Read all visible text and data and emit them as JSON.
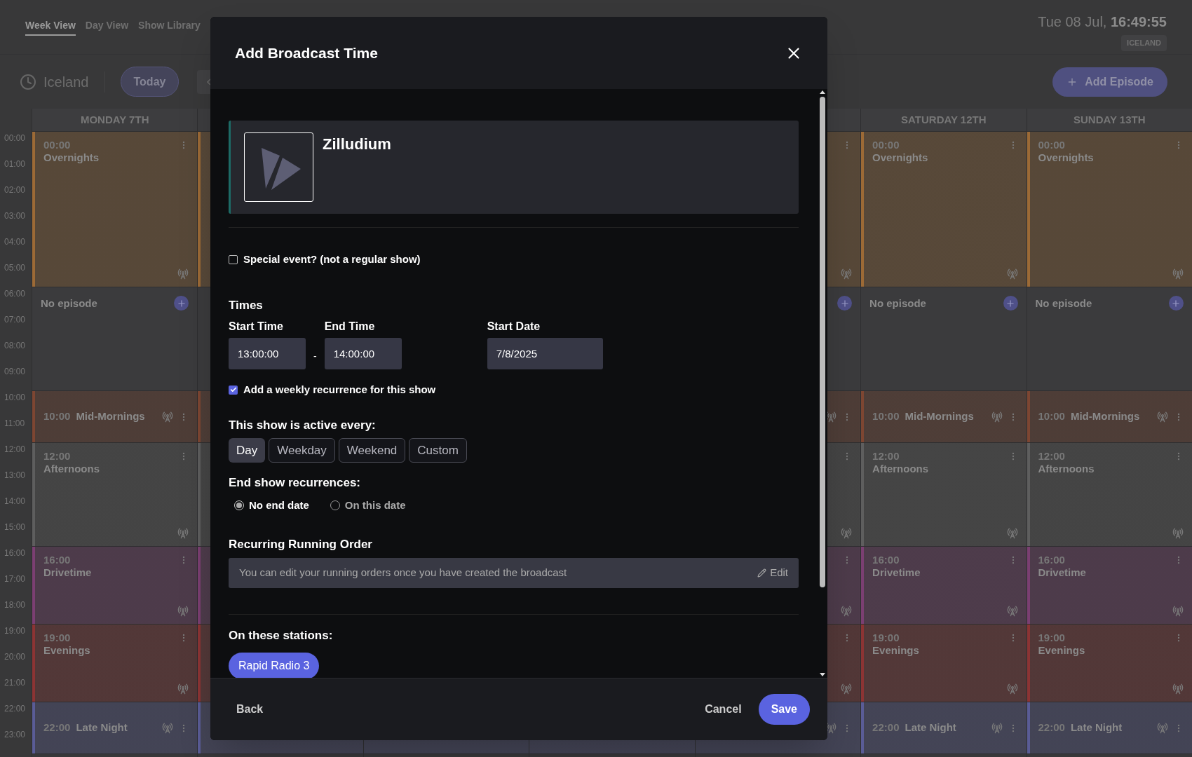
{
  "nav": {
    "tabs": [
      {
        "label": "Week View",
        "selected": true
      },
      {
        "label": "Day View",
        "selected": false
      },
      {
        "label": "Show Library",
        "selected": false
      }
    ]
  },
  "toolbar": {
    "timezone": "Iceland",
    "today": "Today",
    "clock_date": "Tue 08 Jul, ",
    "clock_time": "16:49:55",
    "zone_badge": "ICELAND",
    "add_episode": "Add Episode"
  },
  "hours": [
    "00:00",
    "01:00",
    "02:00",
    "03:00",
    "04:00",
    "05:00",
    "06:00",
    "07:00",
    "08:00",
    "09:00",
    "10:00",
    "11:00",
    "12:00",
    "13:00",
    "14:00",
    "15:00",
    "16:00",
    "17:00",
    "18:00",
    "19:00",
    "20:00",
    "21:00",
    "22:00",
    "23:00"
  ],
  "days": [
    {
      "header": "MONDAY 7TH",
      "controls": true,
      "slots": [
        {
          "kind": "stacked",
          "time": "00:00",
          "title": "Overnights",
          "color": "#9c6a36"
        },
        {
          "kind": "empty",
          "label": "No episode"
        },
        {
          "kind": "inline",
          "time": "10:00",
          "title": "Mid-Mornings",
          "color": "#7d4632"
        },
        {
          "kind": "stacked",
          "time": "12:00",
          "title": "Afternoons",
          "color": "#5e5e5e"
        },
        {
          "kind": "stacked",
          "time": "16:00",
          "title": "Drivetime",
          "color": "#7b3f72"
        },
        {
          "kind": "stacked",
          "time": "19:00",
          "title": "Evenings",
          "color": "#8c3434"
        },
        {
          "kind": "inline",
          "time": "22:00",
          "title": "Late Night",
          "color": "#5a5c96"
        }
      ]
    },
    {
      "slots": [
        {
          "kind": "stacked",
          "color": "#9c6a36"
        },
        {
          "kind": "empty"
        },
        {
          "kind": "inline",
          "color": "#7d4632"
        },
        {
          "kind": "stacked",
          "color": "#5e5e5e"
        },
        {
          "kind": "stacked",
          "color": "#7b3f72"
        },
        {
          "kind": "stacked",
          "color": "#8c3434"
        },
        {
          "kind": "inline",
          "color": "#5a5c96"
        }
      ]
    },
    {
      "slots": [
        {
          "kind": "stacked"
        },
        {
          "kind": "empty"
        },
        {
          "kind": "inline"
        },
        {
          "kind": "stacked"
        },
        {
          "kind": "stacked"
        },
        {
          "kind": "stacked"
        },
        {
          "kind": "inline"
        }
      ]
    },
    {
      "slots": [
        {
          "kind": "stacked"
        },
        {
          "kind": "empty"
        },
        {
          "kind": "inline"
        },
        {
          "kind": "stacked"
        },
        {
          "kind": "stacked"
        },
        {
          "kind": "stacked"
        },
        {
          "kind": "inline"
        }
      ]
    },
    {
      "controls": true,
      "slots": [
        {
          "kind": "stacked"
        },
        {
          "kind": "empty"
        },
        {
          "kind": "inline"
        },
        {
          "kind": "stacked"
        },
        {
          "kind": "stacked"
        },
        {
          "kind": "stacked"
        },
        {
          "kind": "inline"
        }
      ]
    },
    {
      "header": "SATURDAY 12TH",
      "controls": true,
      "slots": [
        {
          "kind": "stacked",
          "time": "00:00",
          "title": "Overnights",
          "color": "#9c6a36"
        },
        {
          "kind": "empty",
          "label": "No episode"
        },
        {
          "kind": "inline",
          "time": "10:00",
          "title": "Mid-Mornings",
          "color": "#7d4632"
        },
        {
          "kind": "stacked",
          "time": "12:00",
          "title": "Afternoons",
          "color": "#5e5e5e"
        },
        {
          "kind": "stacked",
          "time": "16:00",
          "title": "Drivetime",
          "color": "#7b3f72"
        },
        {
          "kind": "stacked",
          "time": "19:00",
          "title": "Evenings",
          "color": "#8c3434"
        },
        {
          "kind": "inline",
          "time": "22:00",
          "title": "Late Night",
          "color": "#5a5c96"
        }
      ]
    },
    {
      "header": "SUNDAY 13TH",
      "controls": true,
      "slots": [
        {
          "kind": "stacked",
          "time": "00:00",
          "title": "Overnights",
          "color": "#9c6a36"
        },
        {
          "kind": "empty",
          "label": "No episode"
        },
        {
          "kind": "inline",
          "time": "10:00",
          "title": "Mid-Mornings",
          "color": "#7d4632"
        },
        {
          "kind": "stacked",
          "time": "12:00",
          "title": "Afternoons",
          "color": "#5e5e5e"
        },
        {
          "kind": "stacked",
          "time": "16:00",
          "title": "Drivetime",
          "color": "#7b3f72"
        },
        {
          "kind": "stacked",
          "time": "19:00",
          "title": "Evenings",
          "color": "#8c3434"
        },
        {
          "kind": "inline",
          "time": "22:00",
          "title": "Late Night",
          "color": "#5a5c96"
        }
      ]
    }
  ],
  "modal": {
    "title": "Add Broadcast Time",
    "show": {
      "name": "Zilludium"
    },
    "special_event": {
      "label": "Special event? (not a regular show)",
      "checked": false
    },
    "times": {
      "heading": "Times",
      "fields": [
        {
          "label": "Start Time",
          "value": "13:00:00"
        },
        {
          "label": "End Time",
          "value": "14:00:00"
        }
      ],
      "separator": "-",
      "start_date": {
        "label": "Start Date",
        "value": "7/8/2025"
      }
    },
    "weekly": {
      "label": "Add a weekly recurrence for this show",
      "checked": true
    },
    "active_every": {
      "heading": "This show is active every:",
      "options": [
        {
          "label": "Day",
          "selected": true
        },
        {
          "label": "Weekday",
          "selected": false
        },
        {
          "label": "Weekend",
          "selected": false
        },
        {
          "label": "Custom",
          "selected": false
        }
      ]
    },
    "end_recurrence": {
      "heading": "End show recurrences:",
      "options": [
        {
          "label": "No end date",
          "selected": true
        },
        {
          "label": "On this date",
          "selected": false
        }
      ]
    },
    "running_order": {
      "heading": "Recurring Running Order",
      "text": "You can edit your running orders once you have created the broadcast",
      "action": "Edit"
    },
    "stations": {
      "heading": "On these stations:",
      "items": [
        {
          "label": "Rapid Radio 3",
          "selected": true
        }
      ]
    },
    "footer": {
      "back": "Back",
      "cancel": "Cancel",
      "save": "Save"
    }
  }
}
